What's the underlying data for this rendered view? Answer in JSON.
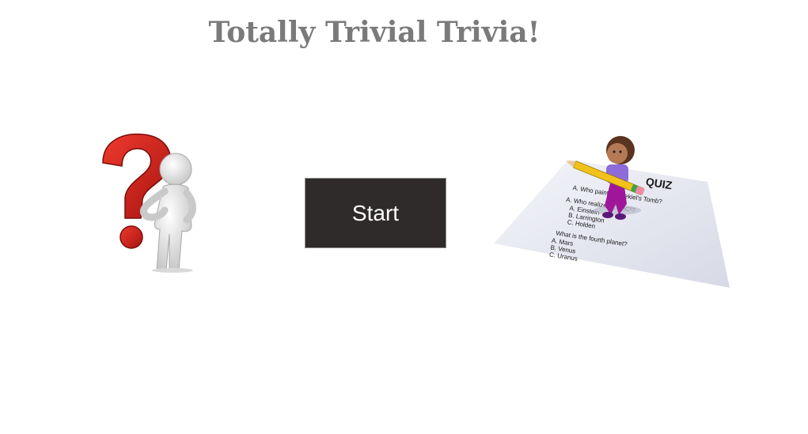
{
  "page": {
    "title": "Totally Trivial Trivia!"
  },
  "start_button": {
    "label": "Start"
  },
  "quiz_sheet": {
    "heading": "QUIZ",
    "lines": [
      "A. Who painted Ezekiel's Tomb?",
      "A. Who realized E=MC²?",
      "A. Einstein",
      "B. Larrington",
      "C. Holden",
      "What is the fourth planet?",
      "A. Mars",
      "B. Venus",
      "C. Uranus"
    ]
  },
  "colors": {
    "title": "#7a7a7a",
    "button_bg": "#2f2b2a",
    "button_text": "#ffffff",
    "question_mark": "#d8201e"
  },
  "icons": {
    "left": "question-mark-figure-icon",
    "right": "quiz-girl-pencil-icon"
  }
}
